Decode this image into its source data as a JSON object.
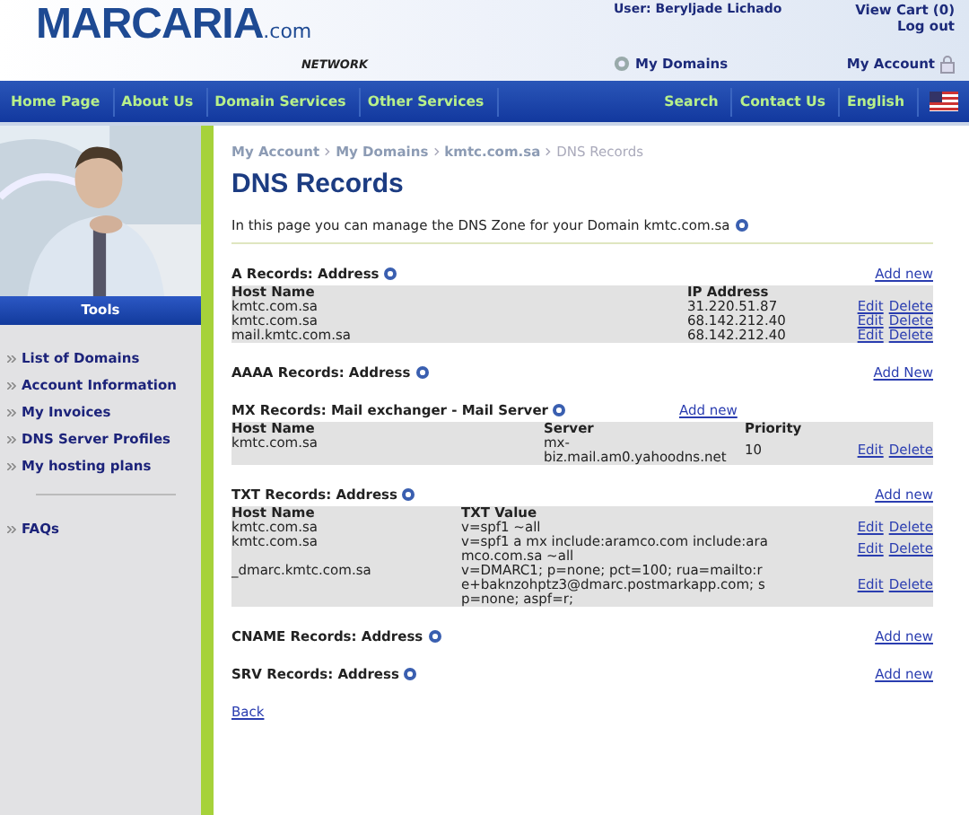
{
  "header": {
    "logo": "MARCARIA",
    "logo_suffix": ".com",
    "logo_sub": "NETWORK",
    "user": "User: Beryljade Lichado",
    "cart": "View Cart (0)",
    "logout": "Log out",
    "my_domains": "My Domains",
    "my_account": "My Account"
  },
  "nav": {
    "left": [
      "Home Page",
      "About Us",
      "Domain Services",
      "Other Services"
    ],
    "right": [
      "Search",
      "Contact Us",
      "English"
    ]
  },
  "sidebar": {
    "title": "Tools",
    "items": [
      "List of Domains",
      "Account Information",
      "My Invoices",
      "DNS Server Profiles",
      "My hosting plans"
    ],
    "extra": [
      "FAQs"
    ]
  },
  "breadcrumb": [
    "My Account",
    "My Domains",
    "kmtc.com.sa",
    "DNS Records"
  ],
  "title": "DNS Records",
  "intro": "In this page you can manage the DNS Zone for your Domain kmtc.com.sa",
  "sections": [
    {
      "kind": "a",
      "title": "A Records: Address",
      "add": "Add new",
      "add_inline": false,
      "columns": [
        "Host Name",
        "IP Address"
      ],
      "rows": [
        {
          "cells": [
            "kmtc.com.sa",
            "31.220.51.87"
          ],
          "actions": [
            "Edit",
            "Delete"
          ]
        },
        {
          "cells": [
            "kmtc.com.sa",
            "68.142.212.40"
          ],
          "actions": [
            "Edit",
            "Delete"
          ]
        },
        {
          "cells": [
            "mail.kmtc.com.sa",
            "68.142.212.40"
          ],
          "actions": [
            "Edit",
            "Delete"
          ]
        }
      ]
    },
    {
      "title": "AAAA Records: Address",
      "add": "Add New",
      "add_inline": false
    },
    {
      "kind": "mx",
      "title": "MX Records: Mail exchanger - Mail Server",
      "add": "Add new",
      "add_inline": true,
      "columns": [
        "Host Name",
        "Server",
        "Priority"
      ],
      "rows": [
        {
          "cells": [
            "kmtc.com.sa",
            "mx-biz.mail.am0.yahoodns.net",
            "10"
          ],
          "actions": [
            "Edit",
            "Delete"
          ]
        }
      ]
    },
    {
      "kind": "txt",
      "title": "TXT Records: Address",
      "add": "Add new",
      "add_inline": false,
      "columns": [
        "Host Name",
        "TXT Value"
      ],
      "rows": [
        {
          "cells": [
            "kmtc.com.sa",
            "v=spf1 ~all"
          ],
          "actions": [
            "Edit",
            "Delete"
          ]
        },
        {
          "cells": [
            "kmtc.com.sa",
            "v=spf1 a mx include:aramco.com include:aramco.com.sa ~all"
          ],
          "actions": [
            "Edit",
            "Delete"
          ]
        },
        {
          "cells": [
            "_dmarc.kmtc.com.sa",
            "v=DMARC1; p=none; pct=100; rua=mailto:re+baknzohptz3@dmarc.postmarkapp.com; sp=none; aspf=r;"
          ],
          "actions": [
            "Edit",
            "Delete"
          ]
        }
      ]
    },
    {
      "title": "CNAME Records: Address",
      "add": "Add new",
      "add_inline": false
    },
    {
      "title": "SRV Records: Address",
      "add": "Add new",
      "add_inline": false
    }
  ],
  "back": "Back"
}
